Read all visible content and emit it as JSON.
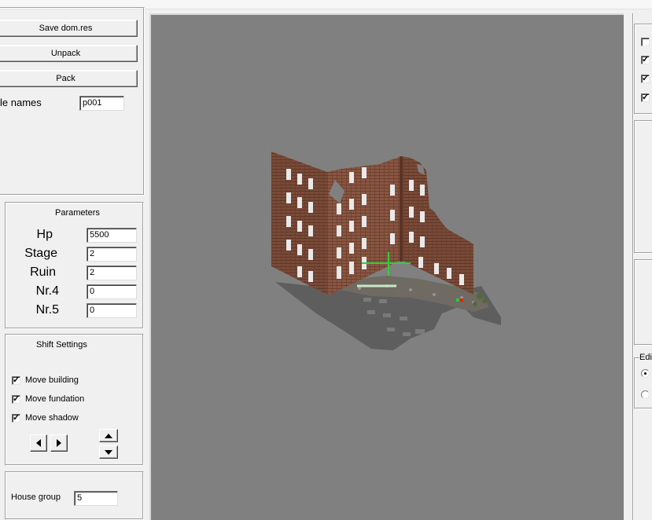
{
  "toolbar": {
    "save_label": "Save dom.res",
    "unpack_label": "Unpack",
    "pack_label": "Pack"
  },
  "file_names": {
    "label": "le names",
    "value": "p001"
  },
  "parameters": {
    "title": "Parameters",
    "fields": [
      {
        "label": "Hp",
        "value": "5500"
      },
      {
        "label": "Stage",
        "value": "2"
      },
      {
        "label": "Ruin",
        "value": "2"
      },
      {
        "label": "Nr.4",
        "value": "0"
      },
      {
        "label": "Nr.5",
        "value": "0"
      }
    ]
  },
  "shift_settings": {
    "title": "Shift Settings",
    "options": [
      {
        "label": "Move building",
        "checked": true
      },
      {
        "label": "Move fundation",
        "checked": true
      },
      {
        "label": "Move shadow",
        "checked": true
      }
    ]
  },
  "house_group": {
    "label": "House group",
    "value": "5"
  },
  "right_panel": {
    "checkboxes": [
      {
        "checked": false
      },
      {
        "checked": true
      },
      {
        "checked": true
      },
      {
        "checked": true
      }
    ],
    "edit_group_label": "Edi",
    "radios": [
      {
        "selected": true
      },
      {
        "selected": false
      }
    ]
  },
  "icons": {
    "left": "arrow-left-icon",
    "right": "arrow-right-icon",
    "up": "arrow-up-icon",
    "down": "arrow-down-icon"
  },
  "colors": {
    "viewport_bg": "#808080",
    "window_bg": "#f0f0f0",
    "brick": "#7a4a38",
    "crosshair": "#2fd03a"
  }
}
